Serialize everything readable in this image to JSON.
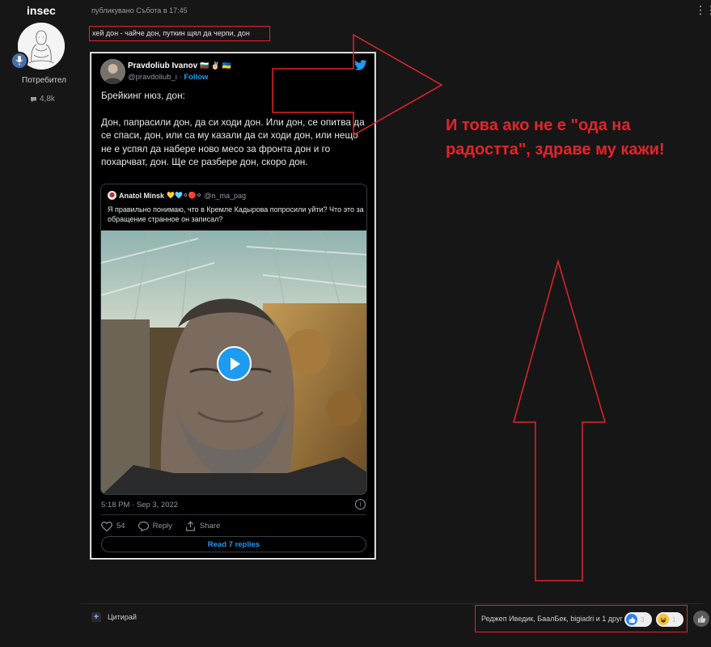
{
  "user": {
    "name": "insec",
    "role": "Потребител",
    "message_count": "4,8k"
  },
  "post": {
    "meta": "публикувано Събота в 17:45",
    "text": "хей дон - чайче дон, путкин щял да черпи, дон",
    "menu": "⋮⋮"
  },
  "tweet": {
    "author_name": "Pravdoliub Ivanov",
    "author_flags": "🇧🇬 ✌🏻 🇺🇦",
    "handle": "@pravdoliub_i",
    "separator": "·",
    "follow": "Follow",
    "body_line1": "Брейкинг нюз, дон:",
    "body_line2": "Дон, папрасили дон, да си ходи дон. Или дон, се опитва да се спаси, дон, или са му казали да си ходи дон, или нещо не е успял да набере ново месо за фронта дон и го похарчват, дон. Ще се разбере дон, скоро дон.",
    "quoted": {
      "name": "Anatol Minsk",
      "emojis": "💛🩵⚪🔴⚪",
      "handle": "@n_ma_pag",
      "text": "Я правильно понимаю, что в Кремле Кадырова попросили уйти? Что это за обращение странное он записал?"
    },
    "timestamp": "5:18 PM · Sep 3, 2022",
    "info": "i",
    "likes": "54",
    "reply": "Reply",
    "share": "Share",
    "read_replies": "Read 7 replies"
  },
  "annotation": {
    "text": "И това ако не е \"ода на радостта\", здраве му кажи!",
    "color": "#e3242b"
  },
  "footer": {
    "quote_label": "Цитирай",
    "reactions_text": "Реджеп Иведик, БаалБек, bigiadri и 1 друг",
    "like_count": "3",
    "haha_count": "1"
  },
  "colors": {
    "background": "#161616",
    "twitter_blue": "#1d9bf0",
    "annotation_red": "#e3242b"
  }
}
